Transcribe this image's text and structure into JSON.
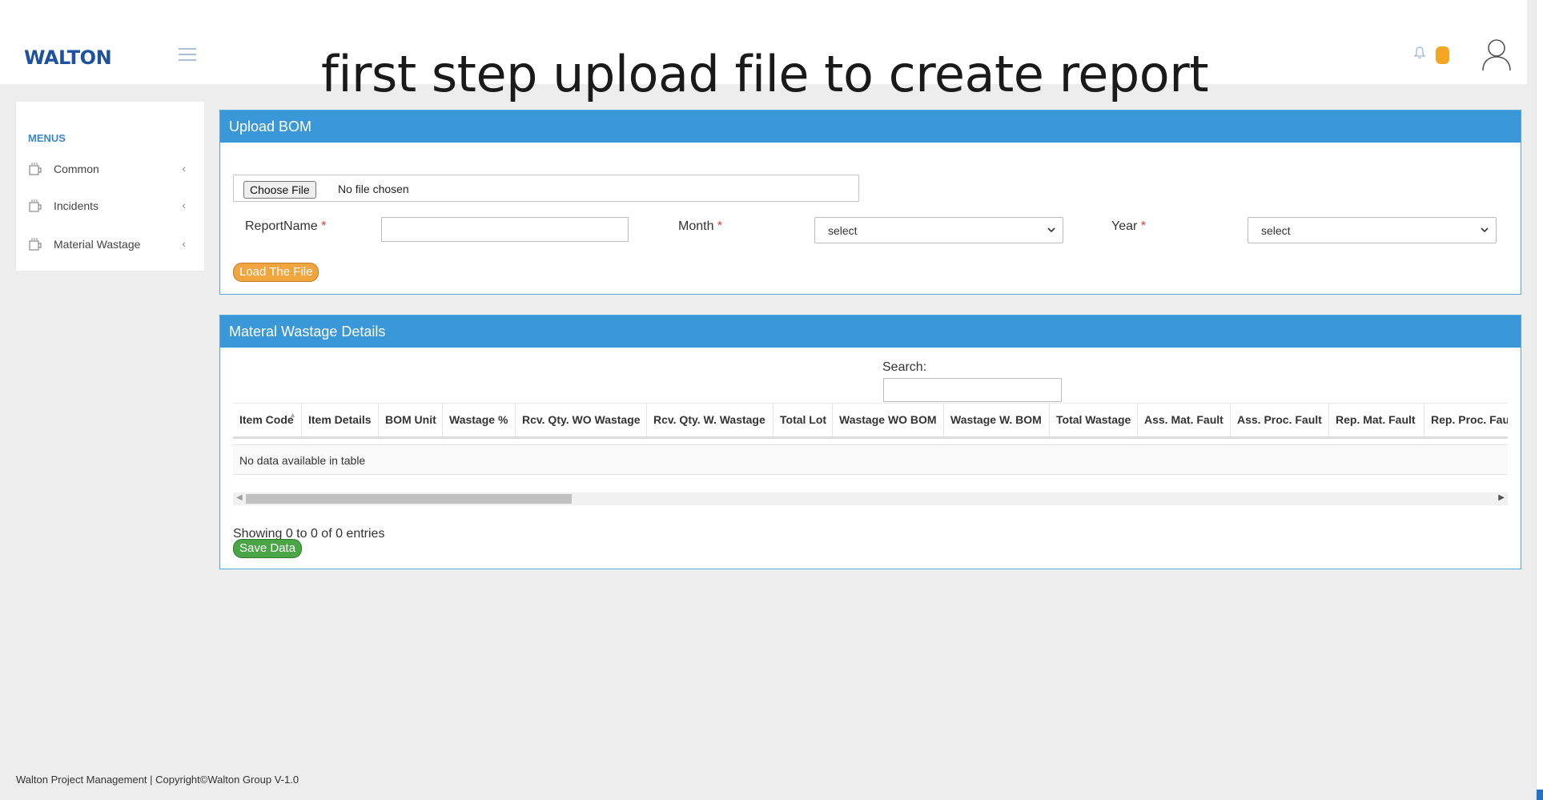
{
  "header": {
    "logo": "WALTON",
    "overlay_title": "first step upload file to create report"
  },
  "sidebar": {
    "section_label": "MENUS",
    "items": [
      {
        "label": "Common"
      },
      {
        "label": "Incidents"
      },
      {
        "label": "Material Wastage"
      }
    ]
  },
  "upload": {
    "title": "Upload BOM",
    "choose_file_label": "Choose File",
    "file_status": "No file chosen",
    "report_name_label": "ReportName",
    "report_name_value": "",
    "month_label": "Month",
    "month_value": "select",
    "year_label": "Year",
    "year_value": "select",
    "required_mark": "*",
    "load_button": "Load The File"
  },
  "details": {
    "title": "Materal Wastage Details",
    "search_label": "Search:",
    "search_value": "",
    "columns": [
      "Item Code",
      "Item Details",
      "BOM Unit",
      "Wastage %",
      "Rcv. Qty. WO Wastage",
      "Rcv. Qty. W. Wastage",
      "Total Lot",
      "Wastage WO BOM",
      "Wastage W. BOM",
      "Total Wastage",
      "Ass. Mat. Fault",
      "Ass. Proc. Fault",
      "Rep. Mat. Fault",
      "Rep. Proc. Fault"
    ],
    "empty_message": "No data available in table",
    "showing_text": "Showing 0 to 0 of 0 entries",
    "save_button": "Save Data"
  },
  "footer": {
    "text": "Walton Project Management | Copyright©Walton Group V-1.0"
  },
  "colors": {
    "header_blue": "#3a98d9",
    "brand_blue": "#1d52a0",
    "load_orange": "#f0a53e",
    "save_green": "#49a545",
    "badge_orange": "#f5a623"
  },
  "icons": {
    "menu": "hamburger-icon",
    "notifications": "bell-icon",
    "user": "user-avatar-icon",
    "sidebar_item": "cup-icon",
    "expand": "chevron-left-icon"
  }
}
